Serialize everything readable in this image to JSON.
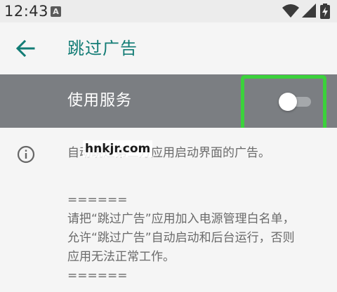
{
  "status_bar": {
    "time": "12:43",
    "notification_badge": "A",
    "icons": [
      "wifi-icon",
      "signal-icon",
      "battery-charging-icon"
    ]
  },
  "app_bar": {
    "back_icon": "arrow-left-icon",
    "title": "跳过广告"
  },
  "service": {
    "label": "使用服务",
    "enabled": false
  },
  "content": {
    "description": "自动跳过第三方应用启动界面的广告。",
    "watermark": "hnkjr.com",
    "notice_lines": [
      "======",
      "请把“跳过广告”应用加入电源管理白名单，",
      "允许“跳过广告”自动启动和后台运行，否则",
      "应用无法正常工作。",
      "======"
    ]
  },
  "colors": {
    "accent": "#127c75",
    "highlight": "#3bd23b",
    "service_row_bg": "#7b7e82",
    "background": "#f5f5f5"
  }
}
